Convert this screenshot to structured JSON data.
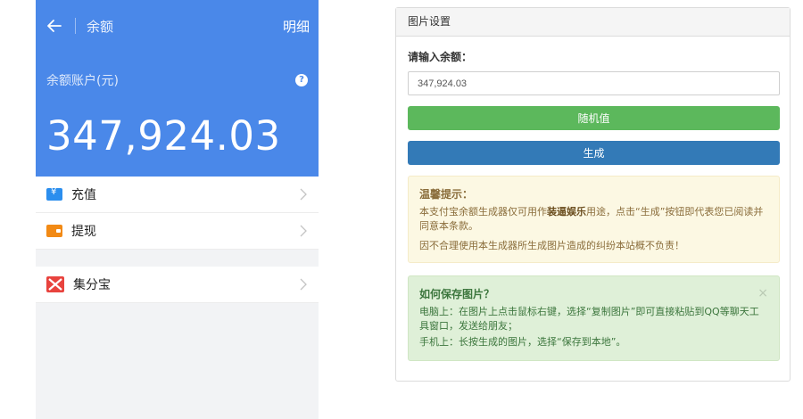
{
  "phone": {
    "title": "余额",
    "detail": "明细",
    "account_label": "余额账户(元)",
    "balance": "347,924.03",
    "help_icon": "?",
    "menu": [
      {
        "label": "充值",
        "icon": "recharge-icon"
      },
      {
        "label": "提现",
        "icon": "withdraw-icon"
      },
      {
        "label": "集分宝",
        "icon": "jifenbao-icon"
      }
    ],
    "colors": {
      "header": "#4a88e9",
      "recharge": "#2b8eee",
      "withdraw": "#f28a15",
      "jifenbao": "#e8433e"
    }
  },
  "panel": {
    "heading": "图片设置",
    "field_label": "请输入余额：",
    "amount_value": "347,924.03",
    "random_button": "随机值",
    "generate_button": "生成",
    "warning": {
      "title": "温馨提示：",
      "line1_a": "本支付宝余额生成器仅可用作",
      "line1_em": "装逼娱乐",
      "line1_b": "用途，点击“生成”按钮即代表您已阅读并同意本条款。",
      "line2": "因不合理使用本生成器所生成图片造成的纠纷本站概不负责！"
    },
    "howto": {
      "title": "如何保存图片？",
      "close": "×",
      "pc": "电脑上：在图片上点击鼠标右键，选择“复制图片”即可直接粘贴到QQ等聊天工具窗口，发送给朋友；",
      "mobile": "手机上：长按生成的图片，选择“保存到本地”。"
    },
    "colors": {
      "random": "#5cb85c",
      "generate": "#337ab7",
      "warning_bg": "#fcf8e3",
      "success_bg": "#dff0d8"
    }
  }
}
